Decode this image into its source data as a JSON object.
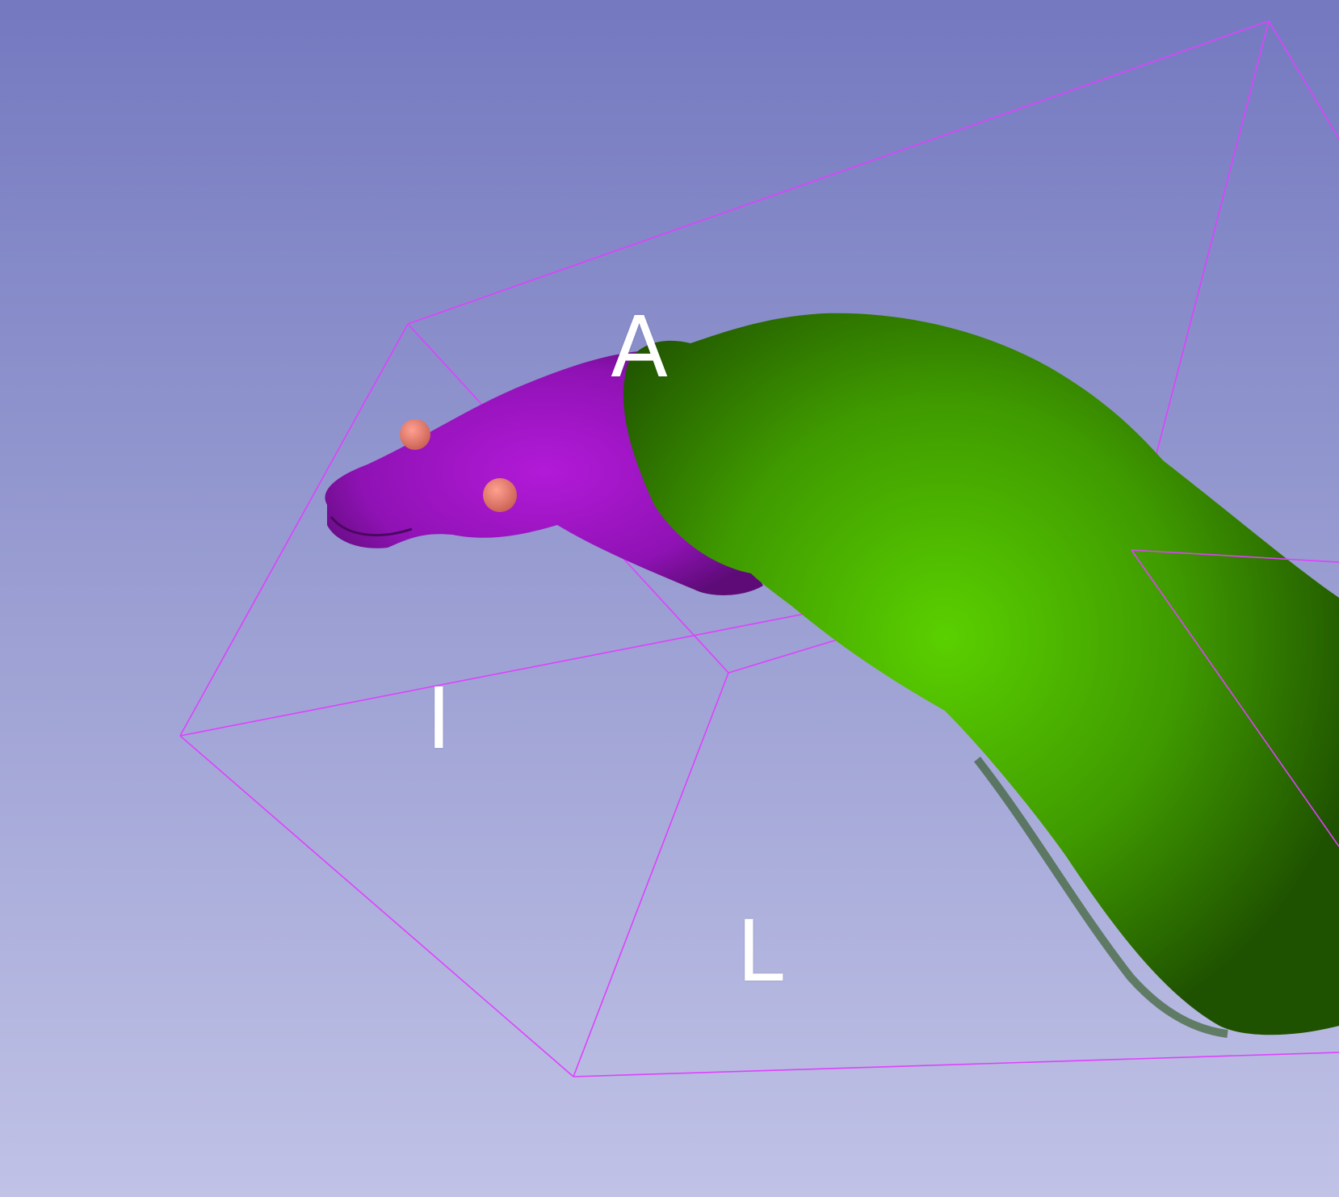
{
  "view": {
    "orientation_labels": {
      "anterior": "A",
      "inferior": "I",
      "left": "L"
    },
    "colors": {
      "background_top": "#7479c0",
      "background_bottom": "#c0c2e6",
      "bounding_box": "#e040ff",
      "model_purple": "#a014c8",
      "model_green": "#4fc000",
      "fiducial": "#f08070"
    },
    "objects": [
      {
        "name": "purple-model",
        "color": "model_purple"
      },
      {
        "name": "green-model",
        "color": "model_green"
      },
      {
        "name": "fiducial-markers",
        "count": 2,
        "color": "fiducial"
      }
    ]
  }
}
